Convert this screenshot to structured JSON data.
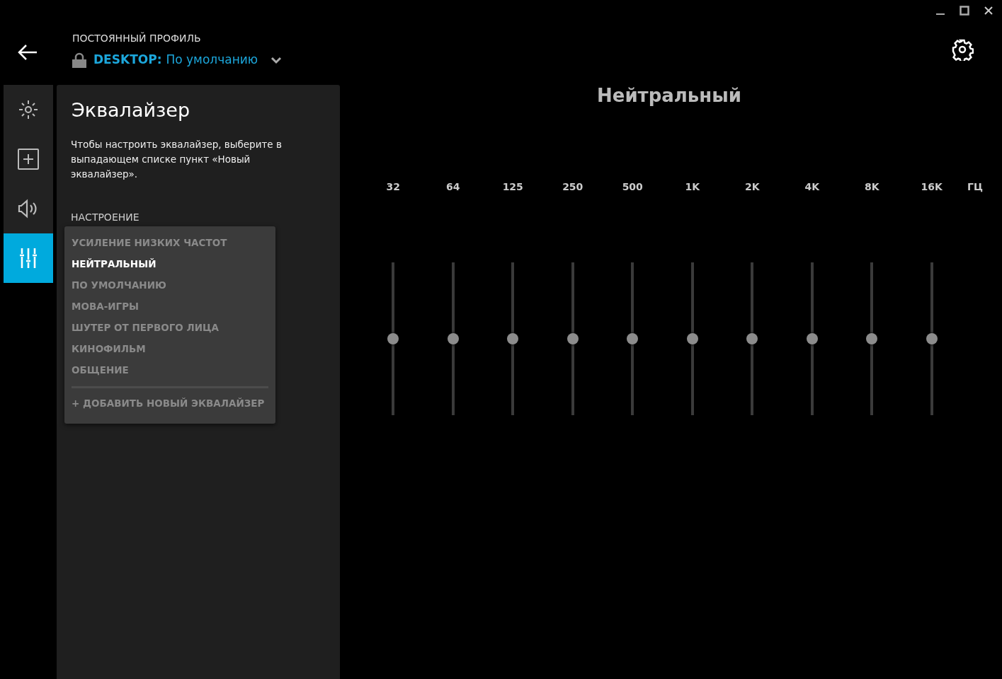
{
  "header": {
    "profile_label": "ПОСТОЯННЫЙ ПРОФИЛЬ",
    "profile_name": "DESKTOP:",
    "profile_value": "По умолчанию",
    "locked": true
  },
  "sidebar": {
    "items": [
      {
        "kind": "lighting",
        "selected": false
      },
      {
        "kind": "add",
        "selected": false
      },
      {
        "kind": "sound",
        "selected": false
      },
      {
        "kind": "equalizer",
        "selected": true
      }
    ]
  },
  "panel": {
    "title": "Эквалайзер",
    "description": "Чтобы настроить эквалайзер, выберите в выпадающем списке пункт «Новый эквалайзер».",
    "section_label": "НАСТРОЕНИЕ",
    "presets": [
      {
        "label": "УСИЛЕНИЕ НИЗКИХ ЧАСТОТ",
        "selected": false
      },
      {
        "label": "НЕЙТРАЛЬНЫЙ",
        "selected": true
      },
      {
        "label": "ПО УМОЛЧАНИЮ",
        "selected": false
      },
      {
        "label": "MOBA-ИГРЫ",
        "selected": false
      },
      {
        "label": "ШУТЕР ОТ ПЕРВОГО ЛИЦА",
        "selected": false
      },
      {
        "label": "КИНОФИЛЬМ",
        "selected": false
      },
      {
        "label": "ОБЩЕНИЕ",
        "selected": false
      }
    ],
    "add_action": "+ ДОБАВИТЬ НОВЫЙ ЭКВАЛАЙЗЕР"
  },
  "equalizer": {
    "title": "Нейтральный",
    "unit": "ГЦ",
    "bands": [
      {
        "label": "32",
        "level": 0.5
      },
      {
        "label": "64",
        "level": 0.5
      },
      {
        "label": "125",
        "level": 0.5
      },
      {
        "label": "250",
        "level": 0.5
      },
      {
        "label": "500",
        "level": 0.5
      },
      {
        "label": "1K",
        "level": 0.5
      },
      {
        "label": "2K",
        "level": 0.5
      },
      {
        "label": "4K",
        "level": 0.5
      },
      {
        "label": "8K",
        "level": 0.5
      },
      {
        "label": "16K",
        "level": 0.5
      }
    ]
  }
}
